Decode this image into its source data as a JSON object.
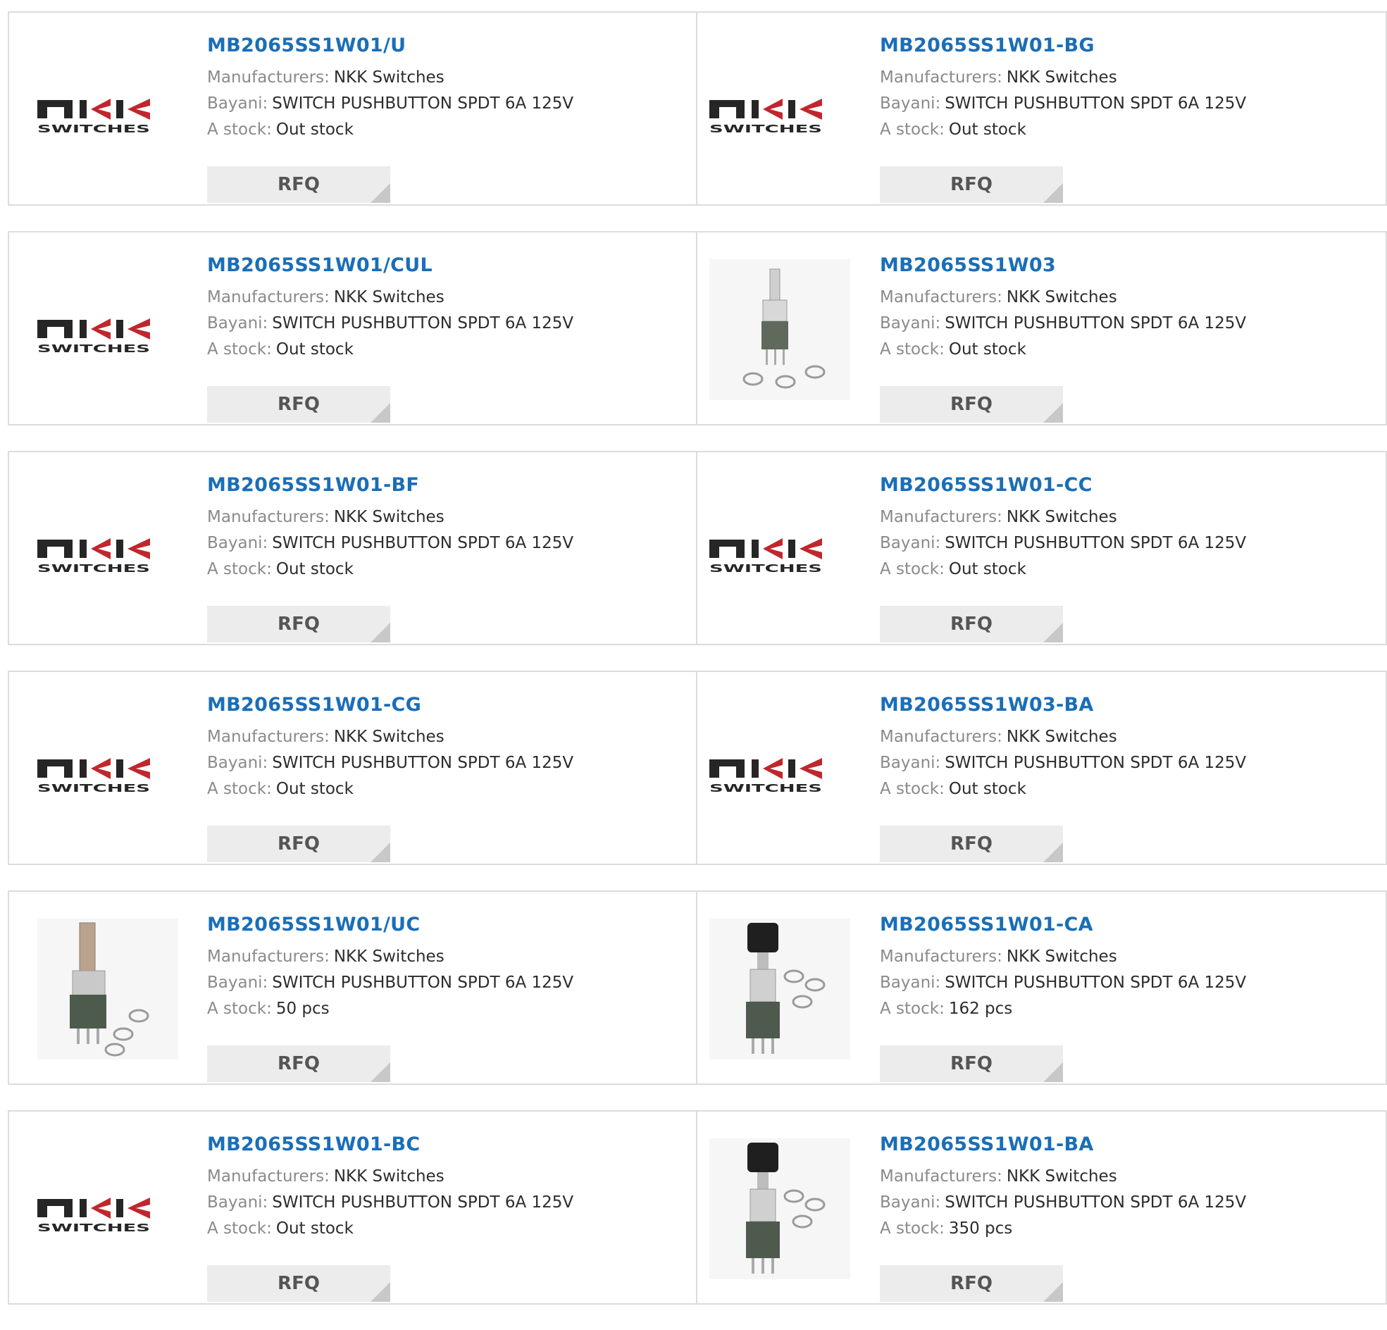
{
  "labels": {
    "manufacturer": "Manufacturers:",
    "description": "Bayani:",
    "stock": "A stock:",
    "rfq": "RFQ"
  },
  "logo": {
    "main": "NKK",
    "sub": "SWITCHES"
  },
  "colors": {
    "title": "#1a6eb8",
    "label": "#8a8a8a",
    "rfq_bg": "#ececec",
    "border": "#dcdcdc"
  },
  "products": [
    {
      "part": "MB2065SS1W01/U",
      "manufacturer": "NKK Switches",
      "description": "SWITCH PUSHBUTTON SPDT 6A 125V",
      "stock": "Out stock",
      "image": "nkk-logo"
    },
    {
      "part": "MB2065SS1W01-BG",
      "manufacturer": "NKK Switches",
      "description": "SWITCH PUSHBUTTON SPDT 6A 125V",
      "stock": "Out stock",
      "image": "nkk-logo"
    },
    {
      "part": "MB2065SS1W01/CUL",
      "manufacturer": "NKK Switches",
      "description": "SWITCH PUSHBUTTON SPDT 6A 125V",
      "stock": "Out stock",
      "image": "nkk-logo"
    },
    {
      "part": "MB2065SS1W03",
      "manufacturer": "NKK Switches",
      "description": "SWITCH PUSHBUTTON SPDT 6A 125V",
      "stock": "Out stock",
      "image": "switch-photo-plain"
    },
    {
      "part": "MB2065SS1W01-BF",
      "manufacturer": "NKK Switches",
      "description": "SWITCH PUSHBUTTON SPDT 6A 125V",
      "stock": "Out stock",
      "image": "nkk-logo"
    },
    {
      "part": "MB2065SS1W01-CC",
      "manufacturer": "NKK Switches",
      "description": "SWITCH PUSHBUTTON SPDT 6A 125V",
      "stock": "Out stock",
      "image": "nkk-logo"
    },
    {
      "part": "MB2065SS1W01-CG",
      "manufacturer": "NKK Switches",
      "description": "SWITCH PUSHBUTTON SPDT 6A 125V",
      "stock": "Out stock",
      "image": "nkk-logo"
    },
    {
      "part": "MB2065SS1W03-BA",
      "manufacturer": "NKK Switches",
      "description": "SWITCH PUSHBUTTON SPDT 6A 125V",
      "stock": "Out stock",
      "image": "nkk-logo"
    },
    {
      "part": "MB2065SS1W01/UC",
      "manufacturer": "NKK Switches",
      "description": "SWITCH PUSHBUTTON SPDT 6A 125V",
      "stock": "50 pcs",
      "image": "switch-photo-threaded"
    },
    {
      "part": "MB2065SS1W01-CA",
      "manufacturer": "NKK Switches",
      "description": "SWITCH PUSHBUTTON SPDT 6A 125V",
      "stock": "162 pcs",
      "image": "switch-photo-capped"
    },
    {
      "part": "MB2065SS1W01-BC",
      "manufacturer": "NKK Switches",
      "description": "SWITCH PUSHBUTTON SPDT 6A 125V",
      "stock": "Out stock",
      "image": "nkk-logo"
    },
    {
      "part": "MB2065SS1W01-BA",
      "manufacturer": "NKK Switches",
      "description": "SWITCH PUSHBUTTON SPDT 6A 125V",
      "stock": "350 pcs",
      "image": "switch-photo-capped"
    }
  ]
}
